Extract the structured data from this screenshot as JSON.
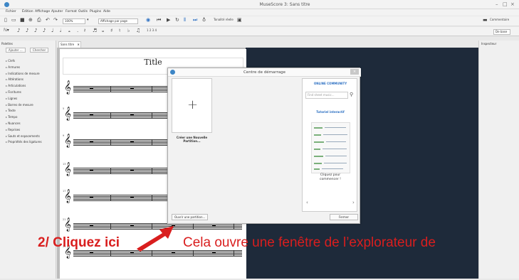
{
  "window": {
    "title": "MuseScore 3: Sans titre"
  },
  "menu": [
    "Fichier",
    "Édition",
    "Affichage",
    "Ajouter",
    "Format",
    "Outils",
    "Plugins",
    "Aide"
  ],
  "toolbar": {
    "zoom": "100%",
    "view_mode": "Affichage par page",
    "tuning": "Tonalité réelle",
    "workspace_btn": "Commentaire",
    "workspace_select": "De base",
    "voices": "1 2 3 4"
  },
  "palettes": {
    "header": "Palettes",
    "add_btn": "Ajouter ...",
    "search_btn": "Chercher",
    "items": [
      "Clefs",
      "Armures",
      "Indications de mesure",
      "Altérations",
      "Articulations",
      "Fioritures",
      "Lignes",
      "Barres de mesure",
      "Texte",
      "Tempo",
      "Nuances",
      "Reprises",
      "Sauts et espacements",
      "Propriétés des ligatures"
    ]
  },
  "tab": {
    "label": "Sans titre"
  },
  "inspector": {
    "header": "Inspecteur"
  },
  "score": {
    "title": "Title",
    "measure_numbers": [
      "5",
      "9",
      "13",
      "17",
      "21",
      "25"
    ]
  },
  "dialog": {
    "title": "Centre de démarrage",
    "new_score_label": "Créer une Nouvelle Partition...",
    "community_title": "ONLINE COMMUNITY",
    "search_placeholder": "Find sheet music...",
    "tutorial_title": "Tutoriel interactif",
    "cta": "Cliquez pour commencer !",
    "open_btn": "Ouvrir une partition...",
    "close_btn": "Fermer"
  },
  "annotation": {
    "step": "2/ Cliquez ici",
    "text": "Cela ouvre une fenêtre de l’explorateur de",
    "color": "#d91e1e"
  }
}
